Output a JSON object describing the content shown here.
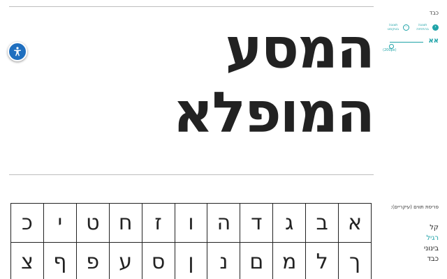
{
  "preview": {
    "line1": "המסע",
    "line2": "המופלא"
  },
  "sidebar": {
    "current_weight": "כבד",
    "view_options": [
      {
        "label": "תצוגה בטקסט",
        "icon": "text-view-icon",
        "selected": false
      },
      {
        "label": "תצוגה בהתחזה",
        "icon": "glyph-view-icon",
        "selected": true
      }
    ],
    "size_glyph": "אא",
    "size_value": "(200px)"
  },
  "weights": {
    "title": "פריסת תווים (עיקריים):",
    "items": [
      {
        "label": "קל",
        "selected": false
      },
      {
        "label": "רגיל",
        "selected": true
      },
      {
        "label": "בינוני",
        "selected": false
      },
      {
        "label": "כבד",
        "selected": false
      }
    ]
  },
  "glyphs": {
    "row1": [
      "א",
      "ב",
      "ג",
      "ד",
      "ה",
      "ו",
      "ז",
      "ח",
      "ט",
      "י",
      "כ"
    ],
    "row2": [
      "ך",
      "ל",
      "מ",
      "ם",
      "נ",
      "ן",
      "ס",
      "ע",
      "פ",
      "ף",
      "צ"
    ]
  },
  "colors": {
    "accent": "#1fa3a8",
    "accessibility": "#1f6fbf",
    "text": "#222222"
  }
}
